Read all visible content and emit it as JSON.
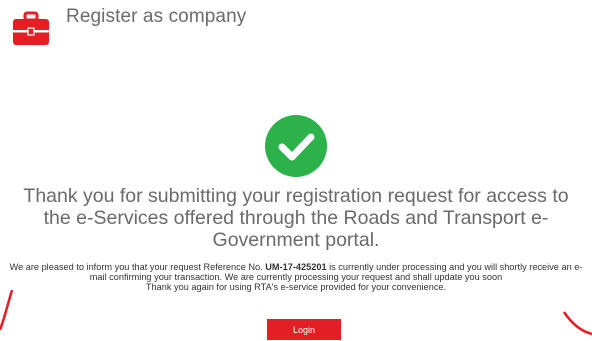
{
  "header": {
    "title": "Register as company",
    "icon": "briefcase-icon"
  },
  "status": {
    "icon": "check-circle-icon",
    "icon_color": "#2db24b"
  },
  "message": {
    "main": "Thank you for submitting your registration request for access to the e-Services offered through the Roads and Transport e-Government portal.",
    "details_prefix": "We are pleased to inform you that your request Reference No. ",
    "reference_no": "UM-17-425201",
    "details_suffix": " is currently under processing and you will shortly receive an e-mail confirming your transaction. We are currently processing your request and shall update you soon",
    "thanks": "Thank you again for using RTA's e-service provided for your convenience."
  },
  "actions": {
    "login_label": "Login"
  },
  "colors": {
    "accent": "#e31e24",
    "success": "#2db24b"
  }
}
